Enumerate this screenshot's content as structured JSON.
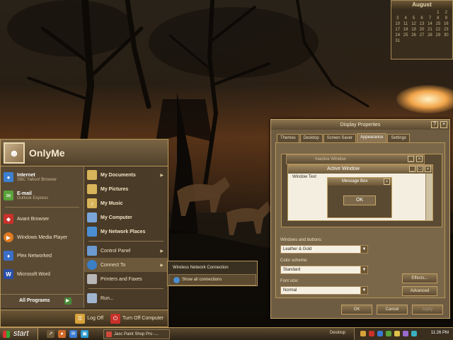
{
  "calendar": {
    "month": "August",
    "days": [
      "",
      "",
      "",
      "",
      "",
      "1",
      "2",
      "3",
      "4",
      "5",
      "6",
      "7",
      "8",
      "9",
      "10",
      "11",
      "12",
      "13",
      "14",
      "15",
      "16",
      "17",
      "18",
      "19",
      "20",
      "21",
      "22",
      "23",
      "24",
      "25",
      "26",
      "27",
      "28",
      "29",
      "30",
      "31"
    ]
  },
  "start_menu": {
    "user_name": "OnlyMe",
    "pinned": [
      {
        "title": "Internet",
        "subtitle": "SBC Yahoo! Browser",
        "icon": "internet-icon",
        "color": "#3d7fd1"
      },
      {
        "title": "E-mail",
        "subtitle": "Outlook Express",
        "icon": "email-icon",
        "color": "#5aa23a"
      }
    ],
    "recent": [
      {
        "label": "Avant Browser",
        "icon": "avant-browser-icon",
        "color": "#c8322a"
      },
      {
        "label": "Windows Media Player",
        "icon": "media-player-icon",
        "color": "#e07a1f"
      },
      {
        "label": "Plex Networked",
        "icon": "plex-icon",
        "color": "#3a6ec8"
      },
      {
        "label": "Microsoft Word",
        "icon": "word-icon",
        "color": "#2a4fa8"
      }
    ],
    "all_programs": "All Programs",
    "right_items": [
      {
        "label": "My Documents",
        "icon": "folder-icon",
        "arrow": true
      },
      {
        "label": "My Pictures",
        "icon": "pictures-icon",
        "arrow": false
      },
      {
        "label": "My Music",
        "icon": "music-icon",
        "arrow": false
      },
      {
        "label": "My Computer",
        "icon": "computer-icon",
        "arrow": false
      },
      {
        "label": "My Network Places",
        "icon": "network-places-icon",
        "arrow": false
      }
    ],
    "system_items": [
      {
        "label": "Control Panel",
        "icon": "control-panel-icon",
        "arrow": true
      },
      {
        "label": "Connect To",
        "icon": "connect-icon",
        "arrow": true
      },
      {
        "label": "Printers and Faxes",
        "icon": "printer-icon",
        "arrow": false
      }
    ],
    "run": "Run...",
    "log_off": "Log Off",
    "turn_off": "Turn Off Computer",
    "submenu": [
      "Wireless Network Connection",
      "Show all connections"
    ]
  },
  "dialog": {
    "title": "Display Properties",
    "tabs": [
      "Themes",
      "Desktop",
      "Screen Saver",
      "Appearance",
      "Settings"
    ],
    "active_tab": "Appearance",
    "preview": {
      "inactive": "Inactive Window",
      "active": "Active Window",
      "window_text": "Window Text",
      "message_box": "Message Box",
      "ok": "OK"
    },
    "windows_and_buttons_label": "Windows and buttons:",
    "windows_and_buttons_value": "Leather & Gold",
    "color_scheme_label": "Color scheme:",
    "color_scheme_value": "Standard",
    "font_size_label": "Font size:",
    "font_size_value": "Normal",
    "effects": "Effects...",
    "advanced": "Advanced",
    "ok": "OK",
    "cancel": "Cancel",
    "apply": "Apply"
  },
  "taskbar": {
    "start": "start",
    "task": "Jasc Paint Shop Pro -...",
    "tray_label": "Desktop",
    "clock": "11:26 PM"
  }
}
